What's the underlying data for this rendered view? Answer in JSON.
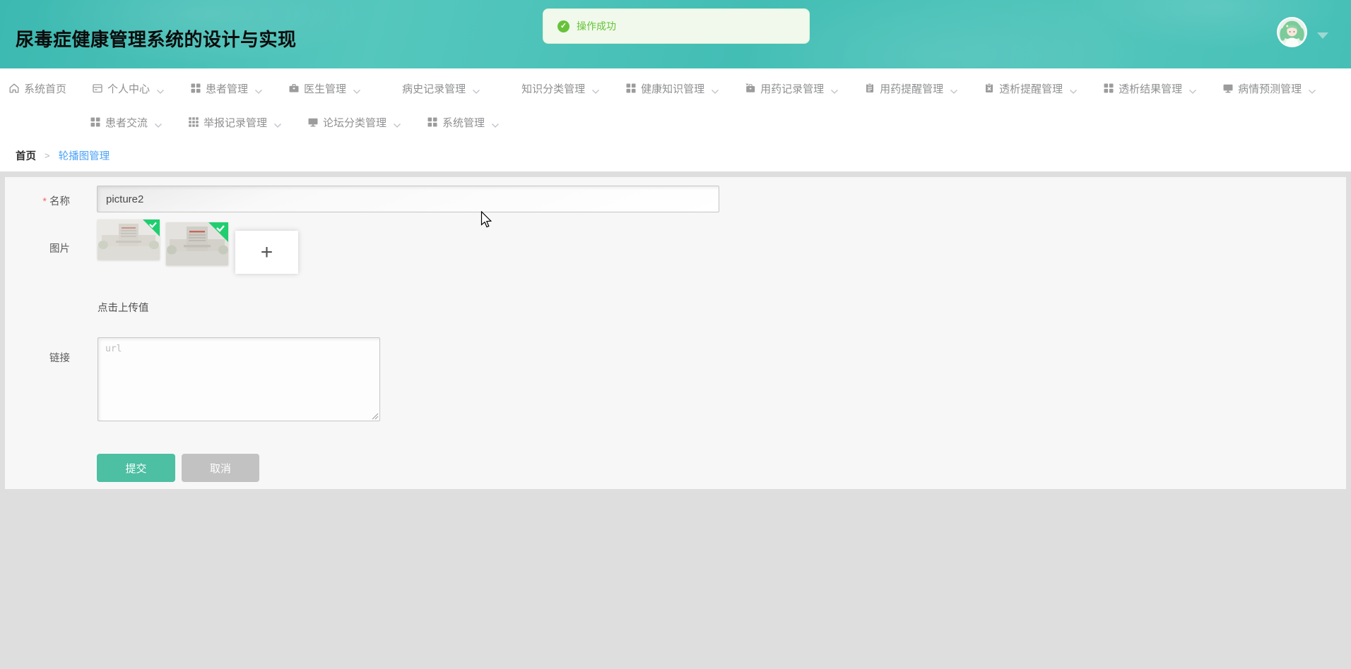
{
  "app": {
    "title": "尿毒症健康管理系统的设计与实现"
  },
  "toast": {
    "message": "操作成功",
    "icon": "check-circle-icon"
  },
  "user": {
    "avatar": "anime-green-hair-avatar"
  },
  "nav": {
    "row1": [
      {
        "label": "系统首页",
        "icon": "home-icon",
        "caret": false
      },
      {
        "label": "个人中心",
        "icon": "window-icon",
        "caret": true
      },
      {
        "label": "患者管理",
        "icon": "grid-icon",
        "caret": true
      },
      {
        "label": "医生管理",
        "icon": "briefcase-icon",
        "caret": true
      },
      {
        "label": "病史记录管理",
        "icon": "list-icon",
        "caret": true
      },
      {
        "label": "知识分类管理",
        "icon": "list-icon",
        "caret": true
      },
      {
        "label": "健康知识管理",
        "icon": "grid-icon",
        "caret": true
      },
      {
        "label": "用药记录管理",
        "icon": "bag-icon",
        "caret": true
      },
      {
        "label": "用药提醒管理",
        "icon": "clipboard-icon",
        "caret": true
      },
      {
        "label": "透析提醒管理",
        "icon": "clipboard-x-icon",
        "caret": true
      },
      {
        "label": "透析结果管理",
        "icon": "grid-icon",
        "caret": true
      },
      {
        "label": "病情预测管理",
        "icon": "monitor-icon",
        "caret": true
      }
    ],
    "row2": [
      {
        "label": "患者交流",
        "icon": "grid-icon",
        "caret": true
      },
      {
        "label": "举报记录管理",
        "icon": "grid3-icon",
        "caret": true
      },
      {
        "label": "论坛分类管理",
        "icon": "monitor-icon",
        "caret": true
      },
      {
        "label": "系统管理",
        "icon": "grid-icon",
        "caret": true
      }
    ]
  },
  "breadcrumb": {
    "home": "首页",
    "separator": ">",
    "current": "轮播图管理"
  },
  "form": {
    "name": {
      "label": "名称",
      "required": "*",
      "value": "picture2"
    },
    "image": {
      "label": "图片",
      "hint": "点击上传值",
      "add_label": "+",
      "thumbnails": [
        {
          "name": "uploaded-image-1",
          "status": "success"
        },
        {
          "name": "uploaded-image-2",
          "status": "success"
        }
      ]
    },
    "link": {
      "label": "链接",
      "placeholder": "url",
      "value": ""
    }
  },
  "actions": {
    "submit": "提交",
    "cancel": "取消"
  },
  "colors": {
    "header_teal": "#46c0b7",
    "accent_green": "#4dbfa3",
    "toast_green": "#67c23a",
    "link_blue": "#4da3f7",
    "badge_green": "#20ce6f",
    "cancel_gray": "#c2c2c2"
  }
}
